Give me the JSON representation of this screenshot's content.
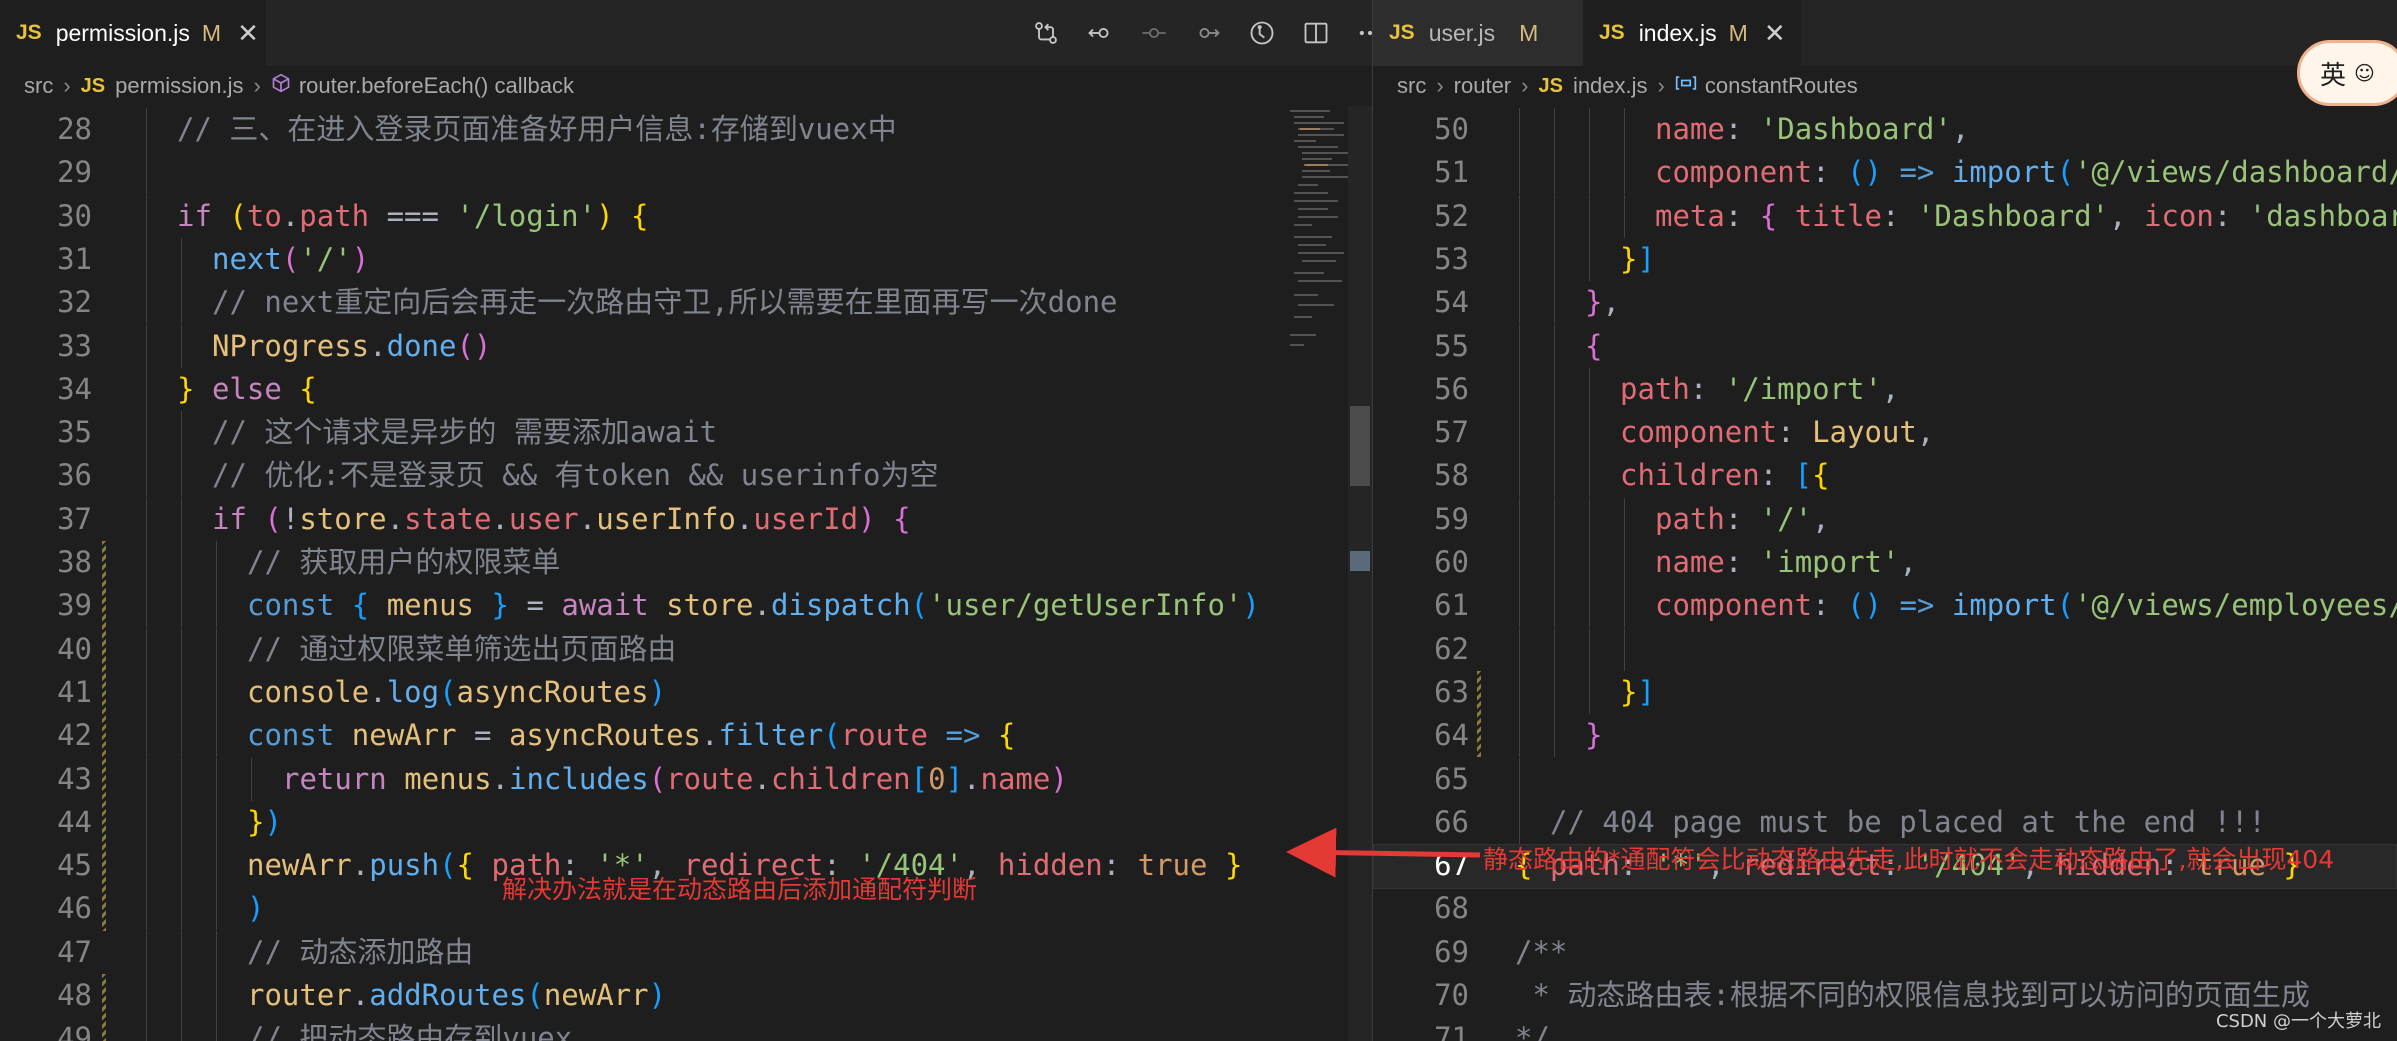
{
  "left": {
    "tab": {
      "icon": "JS",
      "name": "permission.js",
      "modified": "M",
      "close": "✕"
    },
    "toolbar_icons": [
      "source-control-icon",
      "go-back-icon",
      "circle-dot-icon",
      "go-forward-icon",
      "timeline-icon",
      "split-editor-icon",
      "more-actions-icon"
    ],
    "breadcrumb": {
      "folder": "src",
      "file_icon": "JS",
      "file": "permission.js",
      "symbol_icon": "cube-icon",
      "symbol": "router.beforeEach() callback"
    },
    "lines": [
      {
        "n": "28",
        "i": 1,
        "t": [
          [
            "c",
            "// 三、在进入登录页面准备好用户信息:存储到vuex中"
          ]
        ]
      },
      {
        "n": "29",
        "i": 1,
        "t": []
      },
      {
        "n": "30",
        "i": 1,
        "t": [
          [
            "k",
            "if"
          ],
          [
            "pl",
            " "
          ],
          [
            "p",
            "("
          ],
          [
            "v",
            "to"
          ],
          [
            "t",
            "."
          ],
          [
            "v",
            "path"
          ],
          [
            "pl",
            " "
          ],
          [
            "t",
            "==="
          ],
          [
            "pl",
            " "
          ],
          [
            "s",
            "'/login'"
          ],
          [
            "p",
            ")"
          ],
          [
            "pl",
            " "
          ],
          [
            "p",
            "{"
          ]
        ]
      },
      {
        "n": "31",
        "i": 2,
        "t": [
          [
            "f",
            "next"
          ],
          [
            "p2",
            "("
          ],
          [
            "s",
            "'/'"
          ],
          [
            "p2",
            ")"
          ]
        ]
      },
      {
        "n": "32",
        "i": 2,
        "t": [
          [
            "c",
            "// next重定向后会再走一次路由守卫,所以需要在里面再写一次done"
          ]
        ]
      },
      {
        "n": "33",
        "i": 2,
        "t": [
          [
            "y",
            "NProgress"
          ],
          [
            "t",
            "."
          ],
          [
            "f",
            "done"
          ],
          [
            "p2",
            "()"
          ]
        ]
      },
      {
        "n": "34",
        "i": 1,
        "t": [
          [
            "p",
            "}"
          ],
          [
            "pl",
            " "
          ],
          [
            "k",
            "else"
          ],
          [
            "pl",
            " "
          ],
          [
            "p",
            "{"
          ]
        ]
      },
      {
        "n": "35",
        "i": 2,
        "t": [
          [
            "c",
            "// 这个请求是异步的 需要添加await"
          ]
        ]
      },
      {
        "n": "36",
        "i": 2,
        "t": [
          [
            "c",
            "// 优化:不是登录页 && 有token && userinfo为空"
          ]
        ]
      },
      {
        "n": "37",
        "i": 2,
        "t": [
          [
            "k",
            "if"
          ],
          [
            "pl",
            " "
          ],
          [
            "p2",
            "("
          ],
          [
            "t",
            "!"
          ],
          [
            "y",
            "store"
          ],
          [
            "t",
            "."
          ],
          [
            "v",
            "state"
          ],
          [
            "t",
            "."
          ],
          [
            "v",
            "user"
          ],
          [
            "t",
            "."
          ],
          [
            "y",
            "userInfo"
          ],
          [
            "t",
            "."
          ],
          [
            "v",
            "userId"
          ],
          [
            "p2",
            ")"
          ],
          [
            "pl",
            " "
          ],
          [
            "p2",
            "{"
          ]
        ]
      },
      {
        "n": "38",
        "i": 3,
        "t": [
          [
            "c",
            "// 获取用户的权限菜单"
          ]
        ]
      },
      {
        "n": "39",
        "i": 3,
        "t": [
          [
            "kw",
            "const"
          ],
          [
            "pl",
            " "
          ],
          [
            "p3",
            "{"
          ],
          [
            "pl",
            " "
          ],
          [
            "y",
            "menus"
          ],
          [
            "pl",
            " "
          ],
          [
            "p3",
            "}"
          ],
          [
            "pl",
            " "
          ],
          [
            "t",
            "="
          ],
          [
            "pl",
            " "
          ],
          [
            "k",
            "await"
          ],
          [
            "pl",
            " "
          ],
          [
            "y",
            "store"
          ],
          [
            "t",
            "."
          ],
          [
            "f",
            "dispatch"
          ],
          [
            "p3",
            "("
          ],
          [
            "s",
            "'user/getUserInfo'"
          ],
          [
            "p3",
            ")"
          ]
        ]
      },
      {
        "n": "40",
        "i": 3,
        "t": [
          [
            "c",
            "// 通过权限菜单筛选出页面路由"
          ]
        ]
      },
      {
        "n": "41",
        "i": 3,
        "t": [
          [
            "y",
            "console"
          ],
          [
            "t",
            "."
          ],
          [
            "f",
            "log"
          ],
          [
            "p3",
            "("
          ],
          [
            "y",
            "asyncRoutes"
          ],
          [
            "p3",
            ")"
          ]
        ]
      },
      {
        "n": "42",
        "i": 3,
        "t": [
          [
            "kw",
            "const"
          ],
          [
            "pl",
            " "
          ],
          [
            "y",
            "newArr"
          ],
          [
            "pl",
            " "
          ],
          [
            "t",
            "="
          ],
          [
            "pl",
            " "
          ],
          [
            "y",
            "asyncRoutes"
          ],
          [
            "t",
            "."
          ],
          [
            "f",
            "filter"
          ],
          [
            "p3",
            "("
          ],
          [
            "v",
            "route"
          ],
          [
            "pl",
            " "
          ],
          [
            "kw",
            "=>"
          ],
          [
            "pl",
            " "
          ],
          [
            "p",
            "{"
          ]
        ]
      },
      {
        "n": "43",
        "i": 4,
        "t": [
          [
            "k",
            "return"
          ],
          [
            "pl",
            " "
          ],
          [
            "y",
            "menus"
          ],
          [
            "t",
            "."
          ],
          [
            "f",
            "includes"
          ],
          [
            "p2",
            "("
          ],
          [
            "v",
            "route"
          ],
          [
            "t",
            "."
          ],
          [
            "v",
            "children"
          ],
          [
            "p3",
            "["
          ],
          [
            "n",
            "0"
          ],
          [
            "p3",
            "]"
          ],
          [
            "t",
            "."
          ],
          [
            "v",
            "name"
          ],
          [
            "p2",
            ")"
          ]
        ]
      },
      {
        "n": "44",
        "i": 3,
        "t": [
          [
            "p",
            "}"
          ],
          [
            "p3",
            ")"
          ]
        ]
      },
      {
        "n": "45",
        "i": 3,
        "t": [
          [
            "y",
            "newArr"
          ],
          [
            "t",
            "."
          ],
          [
            "f",
            "push"
          ],
          [
            "p3",
            "("
          ],
          [
            "p",
            "{"
          ],
          [
            "pl",
            " "
          ],
          [
            "v",
            "path"
          ],
          [
            "t",
            ":"
          ],
          [
            "pl",
            " "
          ],
          [
            "s",
            "'*'"
          ],
          [
            "t",
            ","
          ],
          [
            "pl",
            " "
          ],
          [
            "v",
            "redirect"
          ],
          [
            "t",
            ":"
          ],
          [
            "pl",
            " "
          ],
          [
            "s",
            "'/404'"
          ],
          [
            "t",
            ","
          ],
          [
            "pl",
            " "
          ],
          [
            "v",
            "hidden"
          ],
          [
            "t",
            ":"
          ],
          [
            "pl",
            " "
          ],
          [
            "n",
            "true"
          ],
          [
            "pl",
            " "
          ],
          [
            "p",
            "}"
          ]
        ]
      },
      {
        "n": "46",
        "i": 3,
        "t": [
          [
            "p3",
            ")"
          ]
        ]
      },
      {
        "n": "47",
        "i": 3,
        "t": [
          [
            "c",
            "// 动态添加路由"
          ]
        ]
      },
      {
        "n": "48",
        "i": 3,
        "t": [
          [
            "y",
            "router"
          ],
          [
            "t",
            "."
          ],
          [
            "f",
            "addRoutes"
          ],
          [
            "p3",
            "("
          ],
          [
            "y",
            "newArr"
          ],
          [
            "p3",
            ")"
          ]
        ]
      },
      {
        "n": "49",
        "i": 3,
        "t": [
          [
            "c",
            "// 把动态路由存到vuex"
          ]
        ]
      }
    ]
  },
  "right": {
    "tabs": [
      {
        "icon": "JS",
        "name": "user.js",
        "modified": "M",
        "close": ""
      },
      {
        "icon": "JS",
        "name": "index.js",
        "modified": "M",
        "close": "✕"
      }
    ],
    "breadcrumb": {
      "folder1": "src",
      "folder2": "router",
      "file_icon": "JS",
      "file": "index.js",
      "symbol_icon": "variable-icon",
      "symbol": "constantRoutes"
    },
    "current_line": "67",
    "lines": [
      {
        "n": "50",
        "i": 4,
        "t": [
          [
            "v",
            "name"
          ],
          [
            "t",
            ":"
          ],
          [
            "pl",
            " "
          ],
          [
            "s",
            "'Dashboard'"
          ],
          [
            "t",
            ","
          ]
        ]
      },
      {
        "n": "51",
        "i": 4,
        "t": [
          [
            "v",
            "component"
          ],
          [
            "t",
            ":"
          ],
          [
            "pl",
            " "
          ],
          [
            "p3",
            "()"
          ],
          [
            "pl",
            " "
          ],
          [
            "kw",
            "=>"
          ],
          [
            "pl",
            " "
          ],
          [
            "f",
            "import"
          ],
          [
            "p3",
            "("
          ],
          [
            "s",
            "'@/views/dashboard/index'"
          ],
          [
            "p3",
            ")"
          ]
        ]
      },
      {
        "n": "52",
        "i": 4,
        "t": [
          [
            "v",
            "meta"
          ],
          [
            "t",
            ":"
          ],
          [
            "pl",
            " "
          ],
          [
            "p2",
            "{"
          ],
          [
            "pl",
            " "
          ],
          [
            "v",
            "title"
          ],
          [
            "t",
            ":"
          ],
          [
            "pl",
            " "
          ],
          [
            "s",
            "'Dashboard'"
          ],
          [
            "t",
            ","
          ],
          [
            "pl",
            " "
          ],
          [
            "v",
            "icon"
          ],
          [
            "t",
            ":"
          ],
          [
            "pl",
            " "
          ],
          [
            "s",
            "'dashboard'"
          ],
          [
            "pl",
            " "
          ],
          [
            "p2",
            "}"
          ]
        ]
      },
      {
        "n": "53",
        "i": 3,
        "t": [
          [
            "p",
            "}"
          ],
          [
            "p3",
            "]"
          ]
        ]
      },
      {
        "n": "54",
        "i": 2,
        "t": [
          [
            "p2",
            "}"
          ],
          [
            "t",
            ","
          ]
        ]
      },
      {
        "n": "55",
        "i": 2,
        "t": [
          [
            "p2",
            "{"
          ]
        ]
      },
      {
        "n": "56",
        "i": 3,
        "t": [
          [
            "v",
            "path"
          ],
          [
            "t",
            ":"
          ],
          [
            "pl",
            " "
          ],
          [
            "s",
            "'/import'"
          ],
          [
            "t",
            ","
          ]
        ]
      },
      {
        "n": "57",
        "i": 3,
        "t": [
          [
            "v",
            "component"
          ],
          [
            "t",
            ":"
          ],
          [
            "pl",
            " "
          ],
          [
            "y",
            "Layout"
          ],
          [
            "t",
            ","
          ]
        ]
      },
      {
        "n": "58",
        "i": 3,
        "t": [
          [
            "v",
            "children"
          ],
          [
            "t",
            ":"
          ],
          [
            "pl",
            " "
          ],
          [
            "p3",
            "["
          ],
          [
            "p",
            "{"
          ]
        ]
      },
      {
        "n": "59",
        "i": 4,
        "t": [
          [
            "v",
            "path"
          ],
          [
            "t",
            ":"
          ],
          [
            "pl",
            " "
          ],
          [
            "s",
            "'/'"
          ],
          [
            "t",
            ","
          ]
        ]
      },
      {
        "n": "60",
        "i": 4,
        "t": [
          [
            "v",
            "name"
          ],
          [
            "t",
            ":"
          ],
          [
            "pl",
            " "
          ],
          [
            "s",
            "'import'"
          ],
          [
            "t",
            ","
          ]
        ]
      },
      {
        "n": "61",
        "i": 4,
        "t": [
          [
            "v",
            "component"
          ],
          [
            "t",
            ":"
          ],
          [
            "pl",
            " "
          ],
          [
            "p3",
            "()"
          ],
          [
            "pl",
            " "
          ],
          [
            "kw",
            "=>"
          ],
          [
            "pl",
            " "
          ],
          [
            "f",
            "import"
          ],
          [
            "p3",
            "("
          ],
          [
            "s",
            "'@/views/employees/import'"
          ],
          [
            "p3",
            ")"
          ]
        ]
      },
      {
        "n": "62",
        "i": 4,
        "t": []
      },
      {
        "n": "63",
        "i": 3,
        "t": [
          [
            "p",
            "}"
          ],
          [
            "p3",
            "]"
          ]
        ]
      },
      {
        "n": "64",
        "i": 2,
        "t": [
          [
            "p2",
            "}"
          ]
        ]
      },
      {
        "n": "65",
        "i": 1,
        "t": []
      },
      {
        "n": "66",
        "i": 1,
        "t": [
          [
            "c",
            "// 404 page must be placed at the end !!!"
          ]
        ]
      },
      {
        "n": "67",
        "i": 0,
        "t": [
          [
            "p",
            "{"
          ],
          [
            "pl",
            " "
          ],
          [
            "v",
            "path"
          ],
          [
            "t",
            ":"
          ],
          [
            "pl",
            " "
          ],
          [
            "s",
            "'*'"
          ],
          [
            "t",
            ","
          ],
          [
            "pl",
            " "
          ],
          [
            "v",
            "redirect"
          ],
          [
            "t",
            ":"
          ],
          [
            "pl",
            " "
          ],
          [
            "s",
            "'/404'"
          ],
          [
            "t",
            ","
          ],
          [
            "pl",
            " "
          ],
          [
            "v",
            "hidden"
          ],
          [
            "t",
            ":"
          ],
          [
            "pl",
            " "
          ],
          [
            "n",
            "true"
          ],
          [
            "pl",
            " "
          ],
          [
            "p",
            "}"
          ]
        ]
      },
      {
        "n": "68",
        "i": 0,
        "t": []
      },
      {
        "n": "69",
        "i": 0,
        "t": [
          [
            "c",
            "/**"
          ]
        ]
      },
      {
        "n": "70",
        "i": 0,
        "t": [
          [
            "c",
            " * 动态路由表:根据不同的权限信息找到可以访问的页面生成"
          ]
        ]
      },
      {
        "n": "71",
        "i": 0,
        "t": [
          [
            "c",
            "*/"
          ]
        ]
      }
    ]
  },
  "annotations": {
    "arrow_note": "静态路由的*通配符会比动态路由先走,此时就不会走动态路由了,就会出现404",
    "solution_note": "解决办法就是在动态路由后添加通配符判断"
  },
  "ime_badge": {
    "label": "英"
  },
  "watermark": "CSDN @一个大萝北",
  "colors": {
    "background": "#1e1e1e",
    "tab_bar": "#252526",
    "comment": "#7f848e",
    "string": "#98c379",
    "keyword": "#c586c0",
    "property": "#e06c75",
    "function": "#61afef",
    "annotation_red": "#e53935",
    "js_badge": "#e8c33b"
  }
}
